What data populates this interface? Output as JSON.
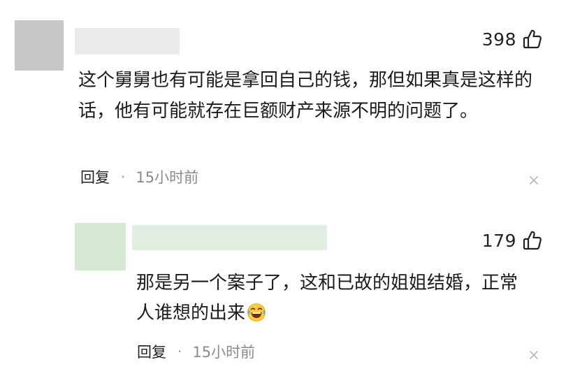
{
  "comments": [
    {
      "likes": "398",
      "text": "这个舅舅也有可能是拿回自己的钱，那但如果真是这样的话，他有可能就存在巨额财产来源不明的问题了。",
      "reply_label": "回复",
      "separator": "·",
      "time": "15小时前",
      "avatar_color": "#c9c7c6",
      "like_icon": "thumbs-up-outline",
      "close_icon": "close-x"
    },
    {
      "likes": "179",
      "text": "那是另一个案子了，这和已故的姐姐结婚，正常人谁想的出来",
      "emoji": "laughing-tears-emoji",
      "reply_label": "回复",
      "separator": "·",
      "time": "15小时前",
      "avatar_color": "#d6ead3",
      "like_icon": "thumbs-up-outline",
      "close_icon": "close-x"
    }
  ]
}
